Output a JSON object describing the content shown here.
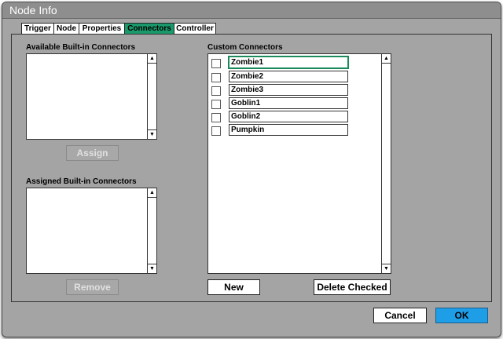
{
  "window": {
    "title": "Node Info"
  },
  "tabs": [
    {
      "label": "Trigger",
      "active": false
    },
    {
      "label": "Node",
      "active": false
    },
    {
      "label": "Properties",
      "active": false
    },
    {
      "label": "Connectors",
      "active": true
    },
    {
      "label": "Controller",
      "active": false
    }
  ],
  "builtin": {
    "available_label": "Available Built-in Connectors",
    "assign_label": "Assign",
    "assigned_label": "Assigned Built-in Connectors",
    "remove_label": "Remove"
  },
  "custom": {
    "label": "Custom Connectors",
    "items": [
      {
        "name": "Zombie1",
        "checked": false,
        "focused": true
      },
      {
        "name": "Zombie2",
        "checked": false
      },
      {
        "name": "Zombie3",
        "checked": false
      },
      {
        "name": "Goblin1",
        "checked": false
      },
      {
        "name": "Goblin2",
        "checked": false
      },
      {
        "name": "Pumpkin",
        "checked": false
      }
    ],
    "new_label": "New",
    "delete_label": "Delete Checked"
  },
  "footer": {
    "cancel_label": "Cancel",
    "ok_label": "OK"
  },
  "icons": {
    "scroll_up": "scroll-up-arrow-icon",
    "scroll_down": "scroll-down-arrow-icon"
  },
  "colors": {
    "active_tab": "#1a9a6a",
    "ok_button": "#1f9ee8",
    "window_bg": "#a4a4a4"
  }
}
